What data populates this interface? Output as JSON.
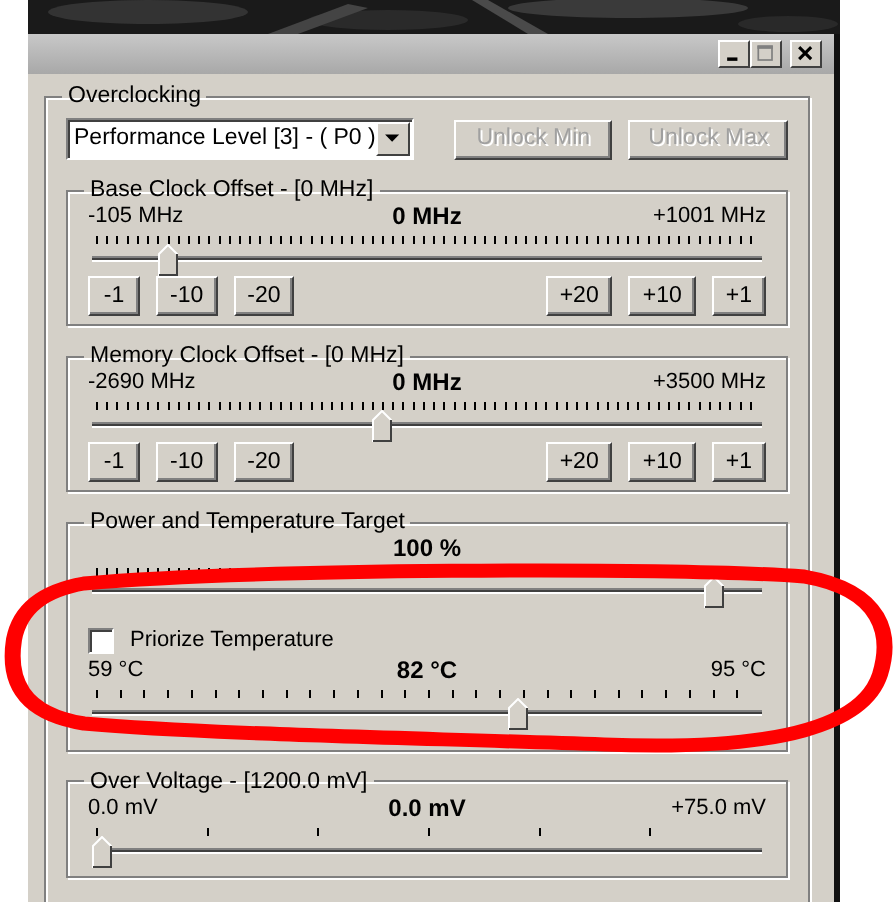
{
  "overclocking": {
    "title": "Overclocking",
    "performance_level": "Performance Level [3] - ( P0 )",
    "buttons": [
      {
        "label": "Unlock Min",
        "disabled": true
      },
      {
        "label": "Unlock Max",
        "disabled": true
      }
    ]
  },
  "groups": [
    {
      "title": "Base Clock Offset - [0 MHz]",
      "sliders": [
        {
          "kind": "fine",
          "min": "-105 MHz",
          "value": "0 MHz",
          "max": "+1001 MHz",
          "level": 0.1
        }
      ],
      "steps_down": [
        "-1",
        "-10",
        "-20"
      ],
      "steps_up": [
        "+20",
        "+10",
        "+1"
      ]
    },
    {
      "title": "Memory Clock Offset - [0 MHz]",
      "sliders": [
        {
          "kind": "fine",
          "min": "-2690 MHz",
          "value": "0 MHz",
          "max": "+3500 MHz",
          "level": 0.43
        }
      ],
      "steps_down": [
        "-1",
        "-10",
        "-20"
      ],
      "steps_up": [
        "+20",
        "+10",
        "+1"
      ]
    },
    {
      "title": "Power and Temperature Target",
      "sliders": [
        {
          "kind": "fine",
          "value": "100 %",
          "level": 0.94
        }
      ],
      "checkbox": {
        "label": "Priorize Temperature",
        "checked": false
      },
      "sliders_after": [
        {
          "kind": "medium",
          "min": "59 °C",
          "value": "82 °C",
          "max": "95 °C",
          "level": 0.64
        }
      ]
    },
    {
      "title": "Over Voltage - [1200.0 mV]",
      "sliders": [
        {
          "kind": "coarse",
          "min": "0.0 mV",
          "value": "0.0 mV",
          "max": "+75.0 mV",
          "level": 0
        }
      ]
    }
  ]
}
